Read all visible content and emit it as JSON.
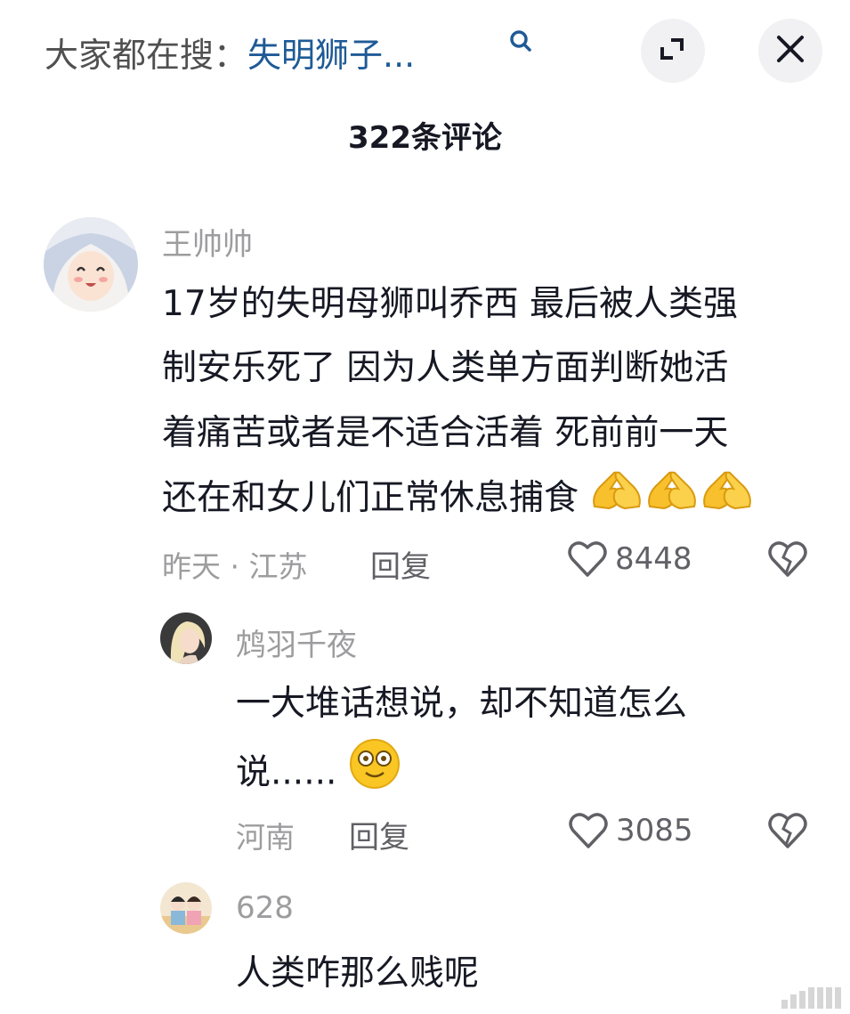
{
  "header": {
    "search_prefix": "大家都在搜：",
    "search_term": "失明狮子...",
    "comment_count": "322条评论"
  },
  "comments": [
    {
      "username": "王帅帅",
      "lines": [
        "17岁的失明母狮叫乔西 最后被人类强",
        "制安乐死了 因为人类单方面判断她活",
        "着痛苦或者是不适合活着 死前前一天",
        "还在和女儿们正常休息捕食"
      ],
      "emoji": [
        "pray-emoji",
        "pray-emoji",
        "pray-emoji"
      ],
      "meta": "昨天 · 江苏",
      "reply_label": "回复",
      "likes": "8448"
    },
    {
      "username": "鸩羽千夜",
      "lines": [
        "一大堆话想说，却不知道怎么",
        "说......"
      ],
      "emoji": [
        "dizzy-face-emoji"
      ],
      "meta": "河南",
      "reply_label": "回复",
      "likes": "3085"
    },
    {
      "username": "628",
      "lines": [
        "人类咋那么贱呢"
      ]
    }
  ],
  "colors": {
    "link_blue": "#1f5a96",
    "muted_gray": "#9d9d9f",
    "text_dark": "#161823"
  }
}
